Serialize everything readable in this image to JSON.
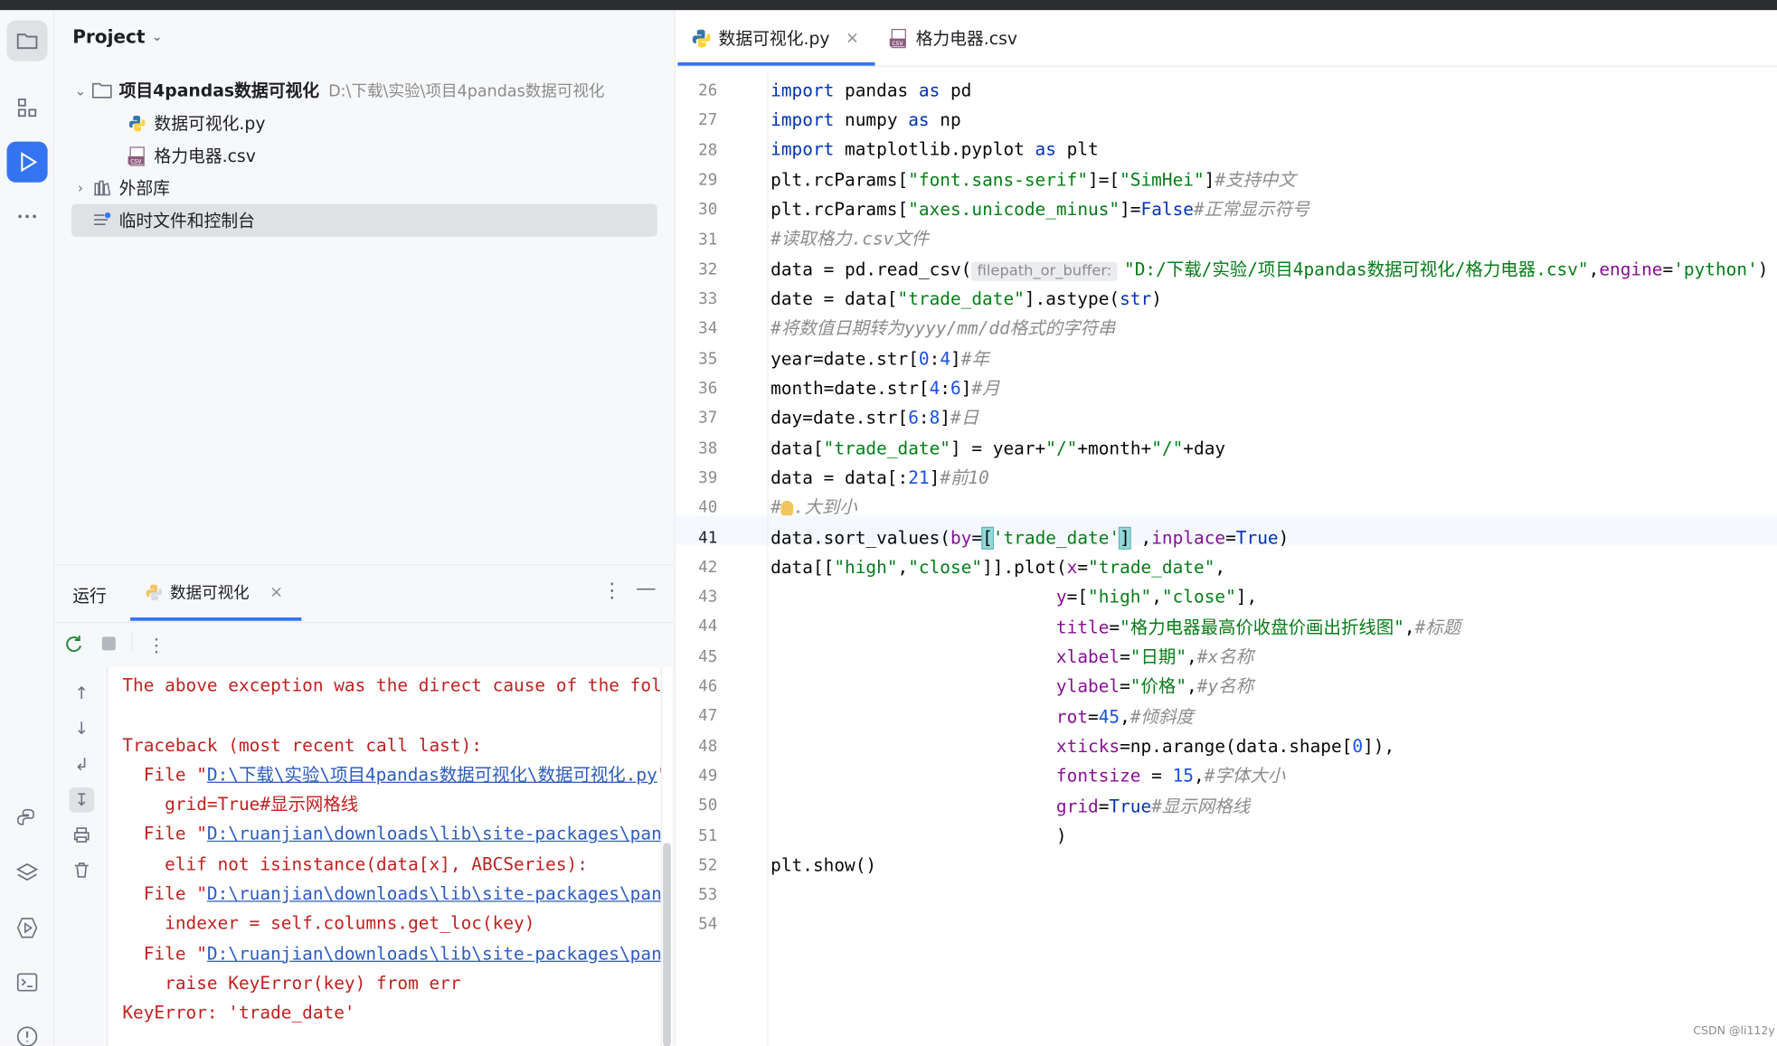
{
  "project": {
    "title": "Project",
    "root_name": "项目4pandas数据可视化",
    "root_path": "D:\\下载\\实验\\项目4pandas数据可视化",
    "files": [
      "数据可视化.py",
      "格力电器.csv"
    ],
    "external_libs": "外部库",
    "scratches": "临时文件和控制台"
  },
  "run": {
    "label": "运行",
    "tab_name": "数据可视化"
  },
  "console_lines": [
    {
      "cls": "err",
      "text": "The above exception was the direct cause of the fol"
    },
    {
      "cls": "err",
      "text": ""
    },
    {
      "cls": "err",
      "text": "Traceback (most recent call last):"
    },
    {
      "cls": "err",
      "prefix": "  File \"",
      "link": "D:\\下载\\实验\\项目4pandas数据可视化\\数据可视化.py",
      "suffix": "\","
    },
    {
      "cls": "err",
      "text": "    grid=True#显示网格线"
    },
    {
      "cls": "err",
      "prefix": "  File \"",
      "link": "D:\\ruanjian\\downloads\\lib\\site-packages\\pan",
      "suffix": ""
    },
    {
      "cls": "err",
      "text": "    elif not isinstance(data[x], ABCSeries):"
    },
    {
      "cls": "err",
      "prefix": "  File \"",
      "link": "D:\\ruanjian\\downloads\\lib\\site-packages\\pan",
      "suffix": ""
    },
    {
      "cls": "err",
      "text": "    indexer = self.columns.get_loc(key)"
    },
    {
      "cls": "err",
      "prefix": "  File \"",
      "link": "D:\\ruanjian\\downloads\\lib\\site-packages\\pan",
      "suffix": ""
    },
    {
      "cls": "err",
      "text": "    raise KeyError(key) from err"
    },
    {
      "cls": "err",
      "text": "KeyError: 'trade_date'"
    }
  ],
  "editor": {
    "tabs": [
      {
        "name": "数据可视化.py",
        "close": "×"
      },
      {
        "name": "格力电器.csv"
      }
    ],
    "line_numbers": [
      "26",
      "27",
      "28",
      "29",
      "30",
      "31",
      "32",
      "33",
      "34",
      "35",
      "36",
      "37",
      "38",
      "39",
      "40",
      "41",
      "42",
      "43",
      "44",
      "45",
      "46",
      "47",
      "48",
      "49",
      "50",
      "51",
      "52",
      "53",
      "54"
    ],
    "param_hint": "filepath_or_buffer:"
  },
  "watermark": "CSDN @li112y"
}
